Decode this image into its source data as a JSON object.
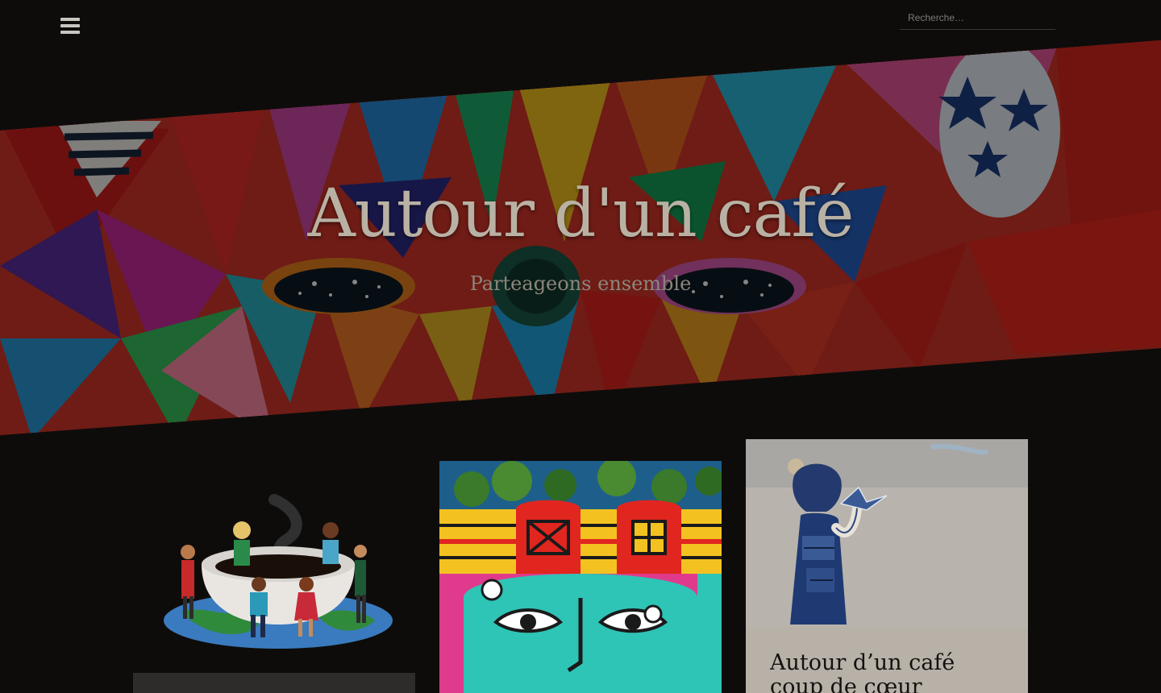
{
  "header": {
    "menu_icon": "hamburger-menu-icon",
    "search": {
      "placeholder": "Recherche…",
      "value": ""
    }
  },
  "hero": {
    "site_title": "Autour d'un café",
    "tagline": "Parteageons ensemble"
  },
  "posts": [
    {
      "image": "coffee-cup-people-illustration",
      "title": ""
    },
    {
      "image": "colorful-street-mural",
      "title": ""
    },
    {
      "image": "girl-paper-crane-graffiti",
      "title": "Autour d’un café coup de cœur"
    }
  ],
  "colors": {
    "background": "#0e0c0b",
    "hero_title": "#b9b2a4",
    "tagline": "#8c867c",
    "card_text_bg": "#b7b1a7"
  }
}
